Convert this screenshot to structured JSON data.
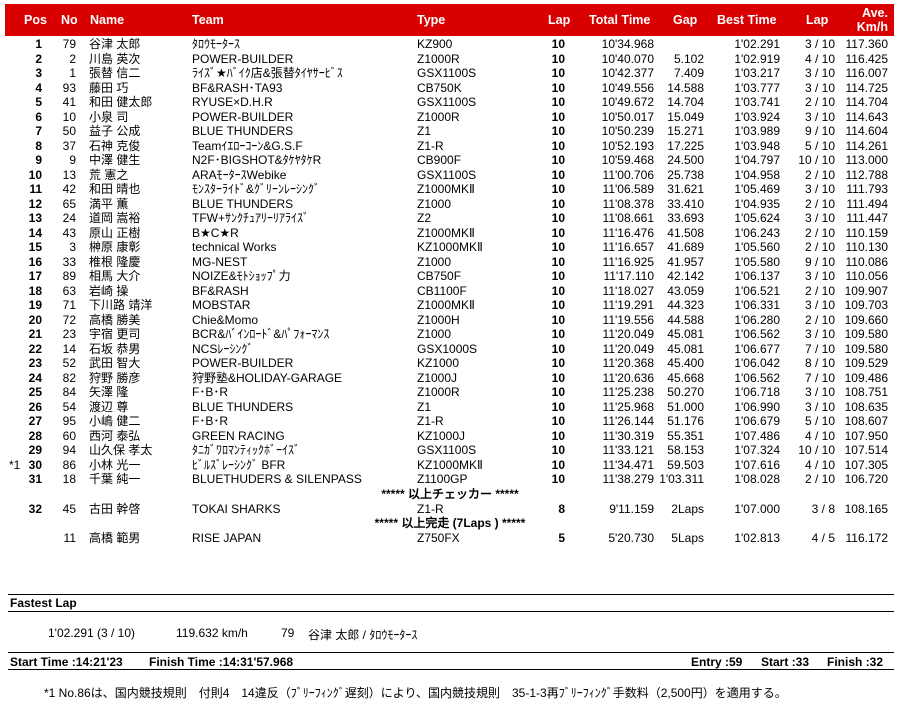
{
  "header": {
    "pos": "Pos",
    "no": "No",
    "name": "Name",
    "team": "Team",
    "type": "Type",
    "lap": "Lap",
    "total_time": "Total Time",
    "gap": "Gap",
    "best_time": "Best Time",
    "best_lap": "Lap",
    "ave_line1": "Ave.",
    "ave_line2": "Km/h",
    "bg_color": "#d80000"
  },
  "rows": [
    {
      "pos": "1",
      "no": "79",
      "name": "谷津 太郎",
      "team": "ﾀﾛｳﾓｰﾀｰｽ",
      "type": "KZ900",
      "lap": "10",
      "total_time": "10'34.968",
      "gap": "",
      "best_time": "1'02.291",
      "best_lap": "3 / 10",
      "ave": "117.360"
    },
    {
      "pos": "2",
      "no": "2",
      "name": "川島 英次",
      "team": "POWER-BUILDER",
      "type": "Z1000R",
      "lap": "10",
      "total_time": "10'40.070",
      "gap": "5.102",
      "best_time": "1'02.919",
      "best_lap": "4 / 10",
      "ave": "116.425"
    },
    {
      "pos": "3",
      "no": "1",
      "name": "張替 信二",
      "team": "ﾗｲｽﾞ★ﾊﾞｲｸ店&張替ﾀｲﾔｻｰﾋﾞｽ",
      "type": "GSX1100S",
      "lap": "10",
      "total_time": "10'42.377",
      "gap": "7.409",
      "best_time": "1'03.217",
      "best_lap": "3 / 10",
      "ave": "116.007"
    },
    {
      "pos": "4",
      "no": "93",
      "name": "藤田 巧",
      "team": "BF&RASH･TA93",
      "type": "CB750K",
      "lap": "10",
      "total_time": "10'49.556",
      "gap": "14.588",
      "best_time": "1'03.777",
      "best_lap": "3 / 10",
      "ave": "114.725"
    },
    {
      "pos": "5",
      "no": "41",
      "name": "和田 健太郎",
      "team": "RYUSE×D.H.R",
      "type": "GSX1100S",
      "lap": "10",
      "total_time": "10'49.672",
      "gap": "14.704",
      "best_time": "1'03.741",
      "best_lap": "2 / 10",
      "ave": "114.704"
    },
    {
      "pos": "6",
      "no": "10",
      "name": "小泉 司",
      "team": "POWER-BUILDER",
      "type": "Z1000R",
      "lap": "10",
      "total_time": "10'50.017",
      "gap": "15.049",
      "best_time": "1'03.924",
      "best_lap": "3 / 10",
      "ave": "114.643"
    },
    {
      "pos": "7",
      "no": "50",
      "name": "益子 公成",
      "team": "BLUE THUNDERS",
      "type": "Z1",
      "lap": "10",
      "total_time": "10'50.239",
      "gap": "15.271",
      "best_time": "1'03.989",
      "best_lap": "9 / 10",
      "ave": "114.604"
    },
    {
      "pos": "8",
      "no": "37",
      "name": "石神 克俊",
      "team": "Teamｲｴﾛｰｺｰﾝ&G.S.F",
      "type": "Z1-R",
      "lap": "10",
      "total_time": "10'52.193",
      "gap": "17.225",
      "best_time": "1'03.948",
      "best_lap": "5 / 10",
      "ave": "114.261"
    },
    {
      "pos": "9",
      "no": "9",
      "name": "中澤 健生",
      "team": "N2F･BIGSHOT&ﾀｹﾔﾀｹR",
      "type": "CB900F",
      "lap": "10",
      "total_time": "10'59.468",
      "gap": "24.500",
      "best_time": "1'04.797",
      "best_lap": "10 / 10",
      "ave": "113.000"
    },
    {
      "pos": "10",
      "no": "13",
      "name": "荒 憲之",
      "team": "ARAﾓｰﾀｰｽWebike",
      "type": "GSX1100S",
      "lap": "10",
      "total_time": "11'00.706",
      "gap": "25.738",
      "best_time": "1'04.958",
      "best_lap": "2 / 10",
      "ave": "112.788"
    },
    {
      "pos": "11",
      "no": "42",
      "name": "和田 晴也",
      "team": "ﾓﾝｽﾀｰﾗｲﾄﾞ&ｸﾞﾘｰﾝﾚｰｼﾝｸﾞ",
      "type": "Z1000MKⅡ",
      "lap": "10",
      "total_time": "11'06.589",
      "gap": "31.621",
      "best_time": "1'05.469",
      "best_lap": "3 / 10",
      "ave": "111.793"
    },
    {
      "pos": "12",
      "no": "65",
      "name": "満平 薫",
      "team": "BLUE THUNDERS",
      "type": "Z1000",
      "lap": "10",
      "total_time": "11'08.378",
      "gap": "33.410",
      "best_time": "1'04.935",
      "best_lap": "2 / 10",
      "ave": "111.494"
    },
    {
      "pos": "13",
      "no": "24",
      "name": "道岡 嵩裕",
      "team": "TFW+ｻﾝｸﾁｭｱﾘｰﾘｱﾗｲｽﾞ",
      "type": "Z2",
      "lap": "10",
      "total_time": "11'08.661",
      "gap": "33.693",
      "best_time": "1'05.624",
      "best_lap": "3 / 10",
      "ave": "111.447"
    },
    {
      "pos": "14",
      "no": "43",
      "name": "原山 正樹",
      "team": "B★C★R",
      "type": "Z1000MKⅡ",
      "lap": "10",
      "total_time": "11'16.476",
      "gap": "41.508",
      "best_time": "1'06.243",
      "best_lap": "2 / 10",
      "ave": "110.159"
    },
    {
      "pos": "15",
      "no": "3",
      "name": "榊原 康彰",
      "team": "technical Works",
      "type": "KZ1000MKⅡ",
      "lap": "10",
      "total_time": "11'16.657",
      "gap": "41.689",
      "best_time": "1'05.560",
      "best_lap": "2 / 10",
      "ave": "110.130"
    },
    {
      "pos": "16",
      "no": "33",
      "name": "椎根 隆慶",
      "team": "MG-NEST",
      "type": "Z1000",
      "lap": "10",
      "total_time": "11'16.925",
      "gap": "41.957",
      "best_time": "1'05.580",
      "best_lap": "9 / 10",
      "ave": "110.086"
    },
    {
      "pos": "17",
      "no": "89",
      "name": "相馬 大介",
      "team": "NOIZE&ﾓﾄｼｮｯﾌﾟ力",
      "type": "CB750F",
      "lap": "10",
      "total_time": "11'17.110",
      "gap": "42.142",
      "best_time": "1'06.137",
      "best_lap": "3 / 10",
      "ave": "110.056"
    },
    {
      "pos": "18",
      "no": "63",
      "name": "岩崎 操",
      "team": "BF&RASH",
      "type": "CB1100F",
      "lap": "10",
      "total_time": "11'18.027",
      "gap": "43.059",
      "best_time": "1'06.521",
      "best_lap": "2 / 10",
      "ave": "109.907"
    },
    {
      "pos": "19",
      "no": "71",
      "name": "下川路 靖洋",
      "team": "MOBSTAR",
      "type": "Z1000MKⅡ",
      "lap": "10",
      "total_time": "11'19.291",
      "gap": "44.323",
      "best_time": "1'06.331",
      "best_lap": "3 / 10",
      "ave": "109.703"
    },
    {
      "pos": "20",
      "no": "72",
      "name": "高橋 勝美",
      "team": "Chie&Momo",
      "type": "Z1000H",
      "lap": "10",
      "total_time": "11'19.556",
      "gap": "44.588",
      "best_time": "1'06.280",
      "best_lap": "2 / 10",
      "ave": "109.660"
    },
    {
      "pos": "21",
      "no": "23",
      "name": "宇宿 更司",
      "team": "BCR&ﾊﾞｲﾝﾛｰﾄﾞ&ﾊﾟﾌｫｰﾏﾝｽ",
      "type": "Z1000",
      "lap": "10",
      "total_time": "11'20.049",
      "gap": "45.081",
      "best_time": "1'06.562",
      "best_lap": "3 / 10",
      "ave": "109.580"
    },
    {
      "pos": "22",
      "no": "14",
      "name": "石坂 恭男",
      "team": "NCSﾚｰｼﾝｸﾞ",
      "type": "GSX1000S",
      "lap": "10",
      "total_time": "11'20.049",
      "gap": "45.081",
      "best_time": "1'06.677",
      "best_lap": "7 / 10",
      "ave": "109.580"
    },
    {
      "pos": "23",
      "no": "52",
      "name": "武田 智大",
      "team": "POWER-BUILDER",
      "type": "KZ1000",
      "lap": "10",
      "total_time": "11'20.368",
      "gap": "45.400",
      "best_time": "1'06.042",
      "best_lap": "8 / 10",
      "ave": "109.529"
    },
    {
      "pos": "24",
      "no": "82",
      "name": "狩野 勝彦",
      "team": "狩野塾&HOLIDAY-GARAGE",
      "type": "Z1000J",
      "lap": "10",
      "total_time": "11'20.636",
      "gap": "45.668",
      "best_time": "1'06.562",
      "best_lap": "7 / 10",
      "ave": "109.486"
    },
    {
      "pos": "25",
      "no": "84",
      "name": "矢澤 隆",
      "team": "F･B･R",
      "type": "Z1000R",
      "lap": "10",
      "total_time": "11'25.238",
      "gap": "50.270",
      "best_time": "1'06.718",
      "best_lap": "3 / 10",
      "ave": "108.751"
    },
    {
      "pos": "26",
      "no": "54",
      "name": "渡辺 尊",
      "team": "BLUE THUNDERS",
      "type": "Z1",
      "lap": "10",
      "total_time": "11'25.968",
      "gap": "51.000",
      "best_time": "1'06.990",
      "best_lap": "3 / 10",
      "ave": "108.635"
    },
    {
      "pos": "27",
      "no": "95",
      "name": "小嶋 健二",
      "team": "F･B･R",
      "type": "Z1-R",
      "lap": "10",
      "total_time": "11'26.144",
      "gap": "51.176",
      "best_time": "1'06.679",
      "best_lap": "5 / 10",
      "ave": "108.607"
    },
    {
      "pos": "28",
      "no": "60",
      "name": "西河 泰弘",
      "team": "GREEN RACING",
      "type": "KZ1000J",
      "lap": "10",
      "total_time": "11'30.319",
      "gap": "55.351",
      "best_time": "1'07.486",
      "best_lap": "4 / 10",
      "ave": "107.950"
    },
    {
      "pos": "29",
      "no": "94",
      "name": "山久保 孝太",
      "team": "ﾀﾆｶﾞﾜﾛﾏﾝﾃｨｯｸﾎﾞｰｲｽﾞ",
      "type": "GSX1100S",
      "lap": "10",
      "total_time": "11'33.121",
      "gap": "58.153",
      "best_time": "1'07.324",
      "best_lap": "10 / 10",
      "ave": "107.514"
    },
    {
      "note": "*1",
      "pos": "30",
      "no": "86",
      "name": "小林 光一",
      "team": "ﾋﾞﾙｽﾞﾚｰｼﾝｸﾞ BFR",
      "type": "KZ1000MKⅡ",
      "lap": "10",
      "total_time": "11'34.471",
      "gap": "59.503",
      "best_time": "1'07.616",
      "best_lap": "4 / 10",
      "ave": "107.305"
    },
    {
      "pos": "31",
      "no": "18",
      "name": "千葉 純一",
      "team": "BLUETHUDERS & SILENPASS",
      "type": "Z1100GP",
      "lap": "10",
      "total_time": "11'38.279",
      "gap": "1'03.311",
      "best_time": "1'08.028",
      "best_lap": "2 / 10",
      "ave": "106.720"
    },
    {
      "separator": "***** 以上チェッカー *****"
    },
    {
      "pos": "32",
      "no": "45",
      "name": "古田 幹啓",
      "team": "TOKAI SHARKS",
      "type": "Z1-R",
      "lap": "8",
      "total_time": "9'11.159",
      "gap": "2Laps",
      "best_time": "1'07.000",
      "best_lap": "3 / 8",
      "ave": "108.165"
    },
    {
      "separator": "***** 以上完走 (7Laps ) *****"
    },
    {
      "pos": "",
      "no": "11",
      "name": "高橋 範男",
      "team": "RISE JAPAN",
      "type": "Z750FX",
      "lap": "5",
      "total_time": "5'20.730",
      "gap": "5Laps",
      "best_time": "1'02.813",
      "best_lap": "4 / 5",
      "ave": "116.172"
    }
  ],
  "fastest_lap": {
    "label": "Fastest Lap",
    "time": "1'02.291 (3 / 10)",
    "speed": "119.632 km/h",
    "no": "79",
    "rider": "谷津 太郎 / ﾀﾛｳﾓｰﾀｰｽ"
  },
  "footer": {
    "start_time": "Start Time :14:21'23",
    "finish_time": "Finish Time :14:31'57.968",
    "entry": "Entry :59",
    "start": "Start :33",
    "finish": "Finish :32"
  },
  "note": "*1 No.86は、国内競技規則　付則4　14違反（ﾌﾞﾘｰﾌｨﾝｸﾞ遅刻）により、国内競技規則　35-1-3再ﾌﾞﾘｰﾌｨﾝｸﾞ手数料（2,500円）を適用する。"
}
